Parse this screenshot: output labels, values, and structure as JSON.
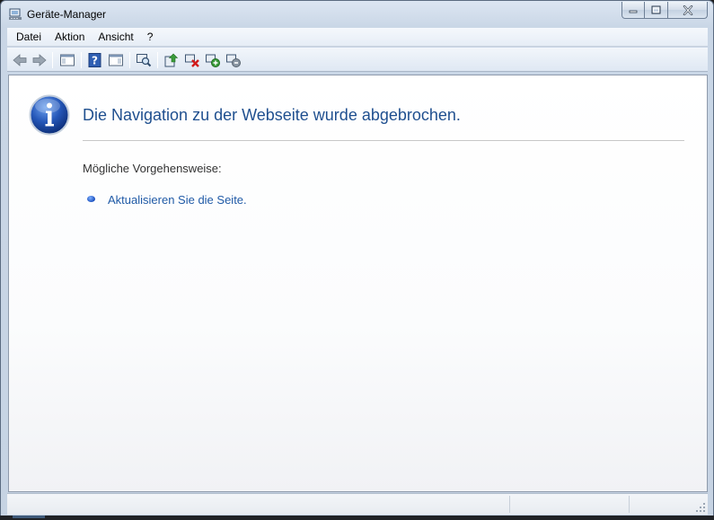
{
  "window": {
    "title": "Geräte-Manager",
    "icon": "device-manager-icon",
    "controls": [
      "minimize-icon",
      "maximize-icon",
      "close-icon"
    ]
  },
  "menu": {
    "items": [
      {
        "label": "Datei"
      },
      {
        "label": "Aktion"
      },
      {
        "label": "Ansicht"
      },
      {
        "label": "?"
      }
    ]
  },
  "toolbar": {
    "buttons": [
      {
        "icon": "back-arrow-icon"
      },
      {
        "icon": "forward-arrow-icon"
      },
      {
        "icon": "show-hide-console-tree-icon"
      },
      {
        "icon": "help-icon"
      },
      {
        "icon": "show-hide-action-pane-icon"
      },
      {
        "icon": "scan-hardware-changes-icon"
      },
      {
        "icon": "update-driver-icon"
      },
      {
        "icon": "uninstall-device-icon"
      },
      {
        "icon": "enable-device-icon"
      },
      {
        "icon": "disable-device-icon"
      }
    ]
  },
  "content": {
    "icon": "info-icon",
    "headline": "Die Navigation zu der Webseite wurde abgebrochen.",
    "subhead": "Mögliche Vorgehensweise:",
    "action_link": "Aktualisieren Sie die Seite."
  },
  "colors": {
    "headline": "#1f4f8f",
    "link": "#1f5aa6",
    "window_frame": "#c9d6e6"
  }
}
